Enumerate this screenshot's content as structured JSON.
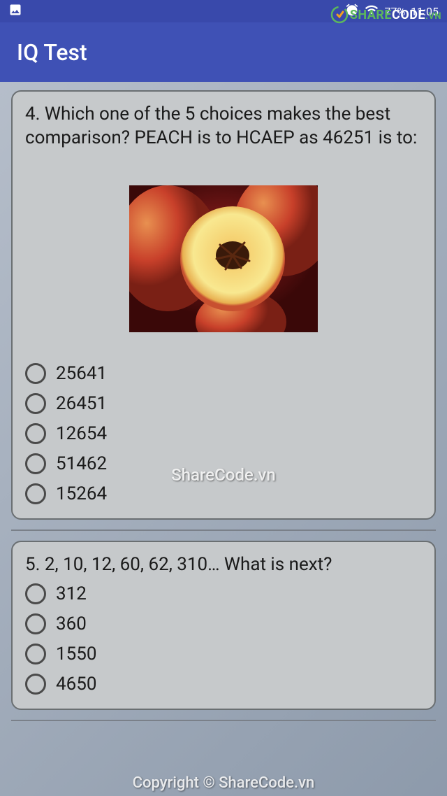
{
  "status": {
    "battery": "77%",
    "time": "11:05"
  },
  "app": {
    "title": "IQ Test"
  },
  "questions": [
    {
      "number": 4,
      "text": "4. Which one of the 5 choices makes the best comparison? PEACH is to HCAEP as 46251 is to:",
      "image_alt": "peach",
      "options": [
        "25641",
        "26451",
        "12654",
        "51462",
        "15264"
      ]
    },
    {
      "number": 5,
      "text": "5. 2, 10, 12, 60, 62, 310… What is next?",
      "options": [
        "312",
        "360",
        "1550",
        "4650"
      ]
    }
  ],
  "watermark": {
    "center": "ShareCode.vn",
    "bottom": "Copyright © ShareCode.vn"
  },
  "logo": {
    "share": "SHARE",
    "code": "CODE",
    "vn": ".VN"
  }
}
